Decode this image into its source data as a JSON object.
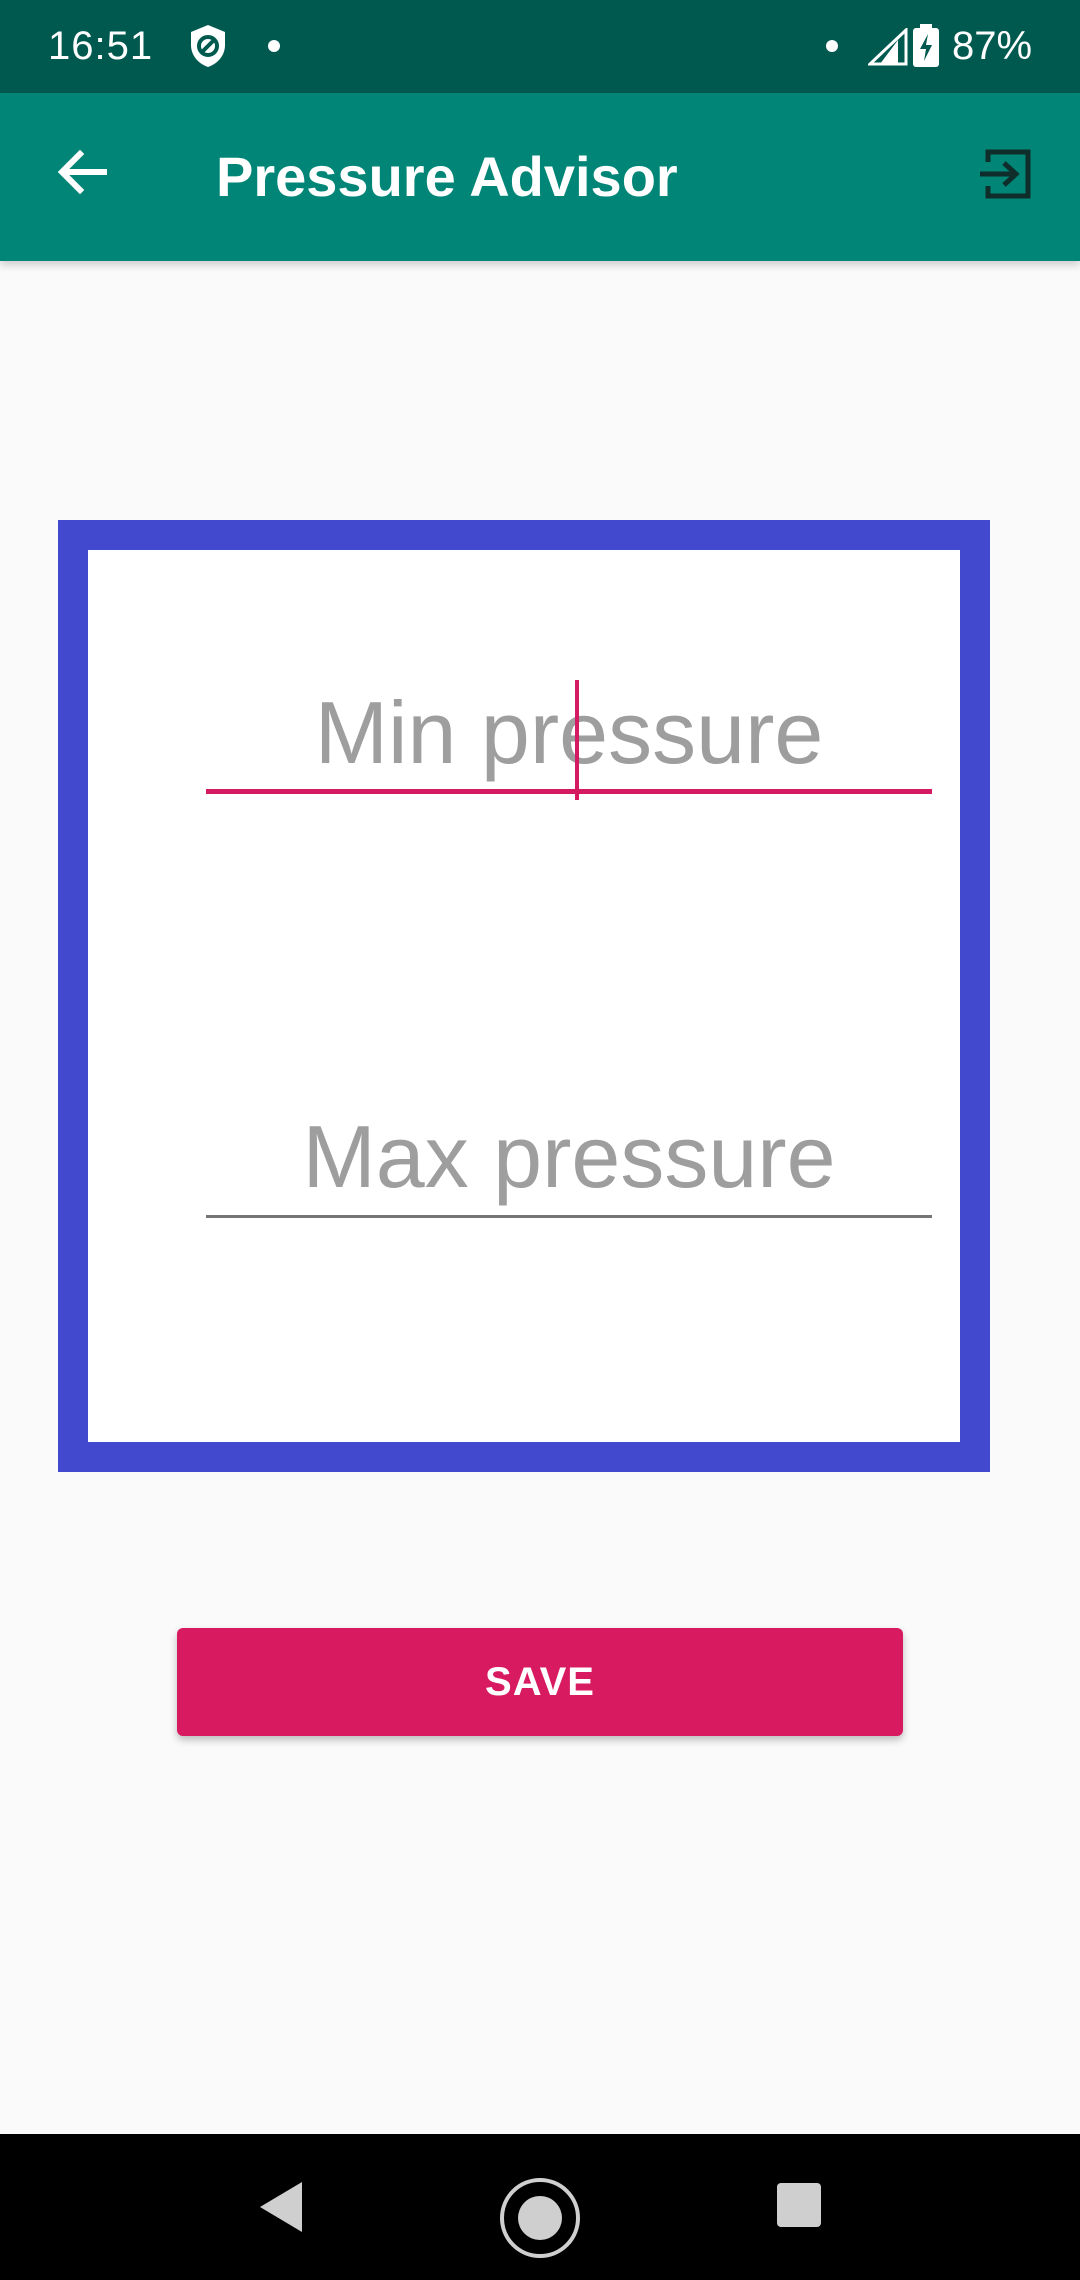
{
  "status_bar": {
    "time": "16:51",
    "battery": "87%",
    "icons": [
      "shield-icon",
      "notification-dot-icon",
      "signal-icon",
      "battery-charging-icon"
    ]
  },
  "app_bar": {
    "title": "Pressure Advisor",
    "back_icon": "arrow-back-icon",
    "action_icon": "exit-to-app-icon",
    "background": "#008577"
  },
  "form": {
    "min_pressure": {
      "placeholder": "Min pressure",
      "value": ""
    },
    "max_pressure": {
      "placeholder": "Max pressure",
      "value": ""
    },
    "frame_color": "#4249cf",
    "accent_color": "#d81b60"
  },
  "actions": {
    "save_label": "SAVE"
  },
  "nav_bar": {
    "icons": [
      "nav-back-icon",
      "nav-home-icon",
      "nav-recents-icon"
    ]
  }
}
